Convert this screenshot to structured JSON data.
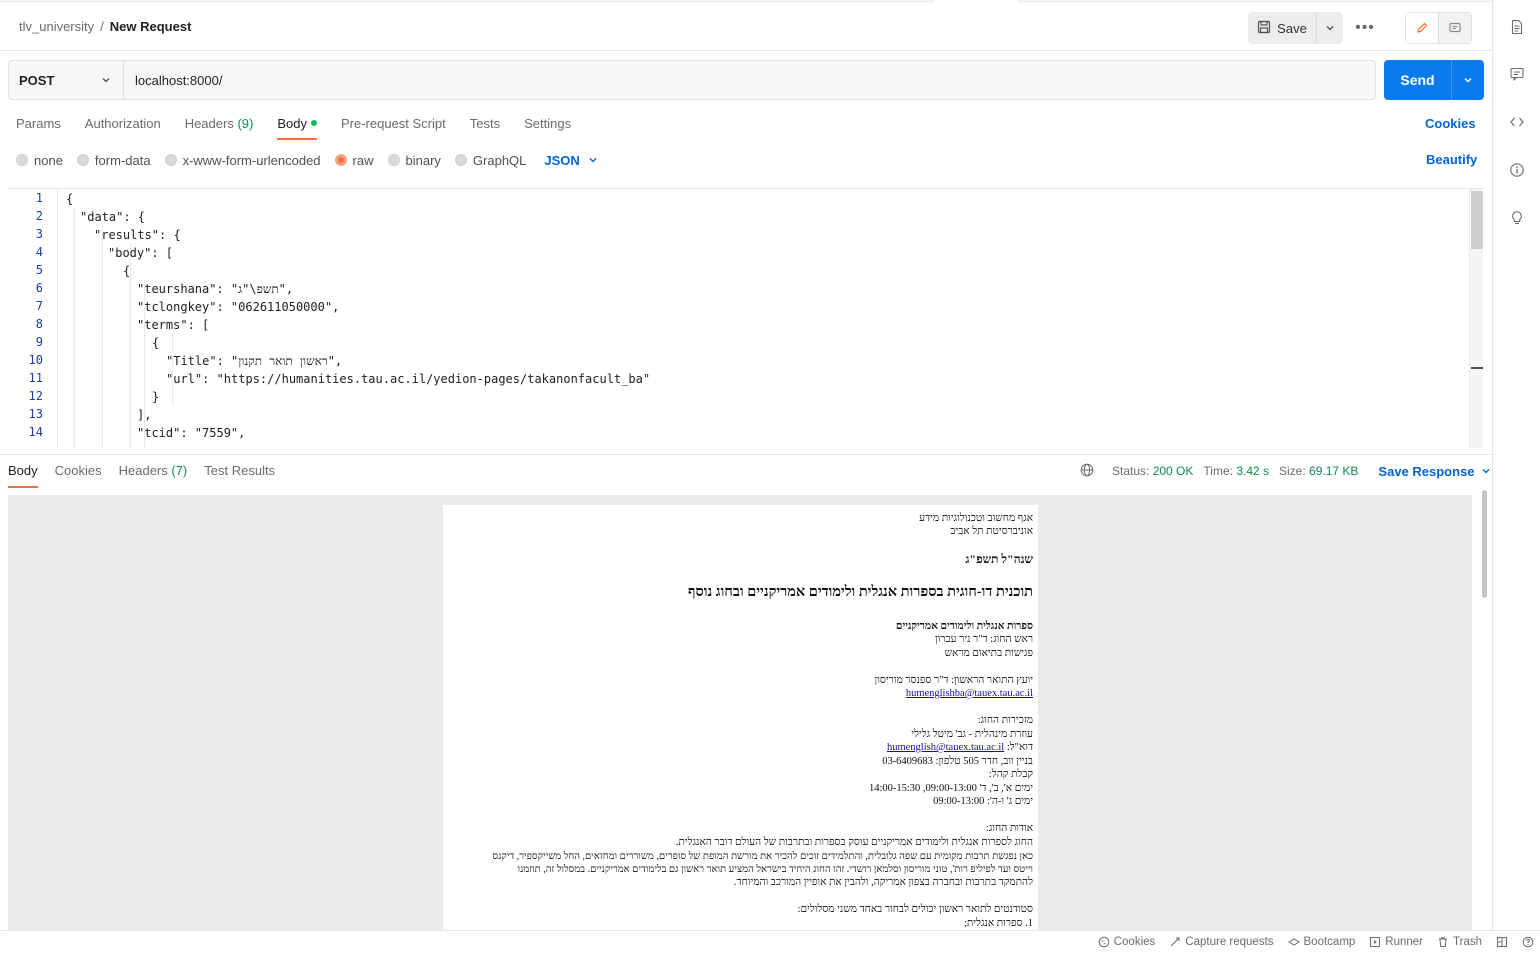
{
  "header": {
    "workspace": "tlv_university",
    "separator": "/",
    "request_name": "New Request",
    "save_label": "Save"
  },
  "request": {
    "method": "POST",
    "url": "localhost:8000/",
    "send_label": "Send",
    "tabs": [
      {
        "label": "Params"
      },
      {
        "label": "Authorization"
      },
      {
        "label": "Headers",
        "count": "(9)"
      },
      {
        "label": "Body"
      },
      {
        "label": "Pre-request Script"
      },
      {
        "label": "Tests"
      },
      {
        "label": "Settings"
      }
    ],
    "cookies_label": "Cookies",
    "body_types": [
      "none",
      "form-data",
      "x-www-form-urlencoded",
      "raw",
      "binary",
      "GraphQL"
    ],
    "selected_body_type": "raw",
    "format": "JSON",
    "beautify_label": "Beautify"
  },
  "editor": {
    "line_numbers": [
      "1",
      "2",
      "3",
      "4",
      "5",
      "6",
      "7",
      "8",
      "9",
      "10",
      "11",
      "12",
      "13",
      "14"
    ],
    "lines": [
      "{",
      "\"data\": {",
      "\"results\": {",
      "\"body\": [",
      "{",
      "\"teurshana\": \"תשפ\\\"ג\",",
      "\"tclongkey\": \"062611050000\",",
      "\"terms\": [",
      "{",
      "\"Title\": \"ראשון תואר תקנון\",",
      "\"url\": \"https://humanities.tau.ac.il/yedion-pages/takanonfacult_ba\"",
      "}",
      "],",
      "\"tcid\": \"7559\","
    ]
  },
  "response": {
    "tabs": [
      {
        "label": "Body"
      },
      {
        "label": "Cookies"
      },
      {
        "label": "Headers",
        "count": "(7)"
      },
      {
        "label": "Test Results"
      }
    ],
    "status_label": "Status:",
    "status_value": "200 OK",
    "time_label": "Time:",
    "time_value": "3.42 s",
    "size_label": "Size:",
    "size_value": "69.17 KB",
    "save_response_label": "Save Response"
  },
  "preview_doc": {
    "dept_line": "אגף מחשוב וטכנולוגיות מידע",
    "university": "אוניברסיטת תל אביב",
    "year": "שנה\"ל תשפ\"ג",
    "program_title": "תוכנית דו-חוגית בספרות אנגלית ולימודים אמריקניים ובחוג נוסף",
    "section_title": "ספרות אנגלית ולימודים אמריקניים",
    "head": "ראש החוג: ד\"ר ניר עברון",
    "meetings": "פגישות בתיאום מראש",
    "advisor": "יועץ התואר הראשון: ד\"ר ספנסר מוריסון",
    "advisor_email": "humenglishba@tauex.tau.ac.il",
    "secretariat": "מזכירות החוג:",
    "admin_assistant": "עוזרת מינהלית - גב' מיטל גלילי",
    "email_label": "דוא\"ל:",
    "secretariat_email": "humenglish@tauex.tau.ac.il",
    "building": "בניין ווב, חדר 505 טלפון: 03-6409683",
    "reception": "קבלת קהל:",
    "hours_1": "ימים א', ב', ד' 09:00-13:00, 14:00-15:30",
    "hours_2": "ימים ג' ו-ה': 09:00-13:00",
    "about": "אודות החוג:",
    "about_p1": "החוג לספרות אנגלית ולימודים אמריקניים עוסק בספרות ובתרבות של העולם דובר האנגלית.",
    "about_p2": "כאן נפגשת תרבות מקומית עם שפה גלובלית, והתלמידים זוכים להכיר את מורשת המופת של סופרים, משוררים ומחזאים, החל משייקספיר, דיקנס",
    "about_p3": "וייטס ועד לפיליפ רות', טוני מוריסון וסלמאן רושדי. זהו החוג היחיד בישראל המציע תואר ראשון גם בלימודים אמריקניים. במסלול זה, תוזמנו",
    "about_p4": "להתמקד בתרבות ובחברה בצפון אמריקה, ולהבין את אופיין המורכב והמיוחד.",
    "tracks_intro": "סטודנטים לתואר ראשון יכולים לבחור באחד משני מסלולים:",
    "track_1": "1. ספרות אנגלית;"
  },
  "footer": {
    "items": [
      "Cookies",
      "Capture requests",
      "Bootcamp",
      "Runner",
      "Trash"
    ]
  },
  "colors": {
    "accent": "#ff6c37",
    "primary": "#097bed",
    "link": "#0265d2",
    "success": "#0f8a4f"
  }
}
